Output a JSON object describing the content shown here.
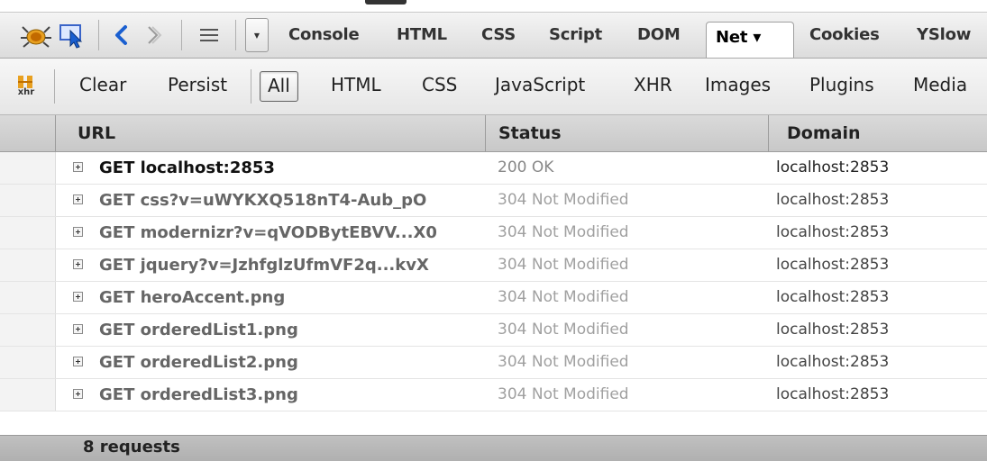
{
  "panel_tabs": [
    {
      "label": "Console"
    },
    {
      "label": "HTML"
    },
    {
      "label": "CSS"
    },
    {
      "label": "Script"
    },
    {
      "label": "DOM"
    },
    {
      "label": "Net ▾",
      "active": true
    },
    {
      "label": "Cookies"
    },
    {
      "label": "YSlow"
    }
  ],
  "toolbar_icons": [
    "firebug-icon",
    "inspect-icon",
    "back-icon",
    "forward-icon",
    "menu-icon",
    "dropdown-icon"
  ],
  "filter_bar": {
    "xhr_icon_label": "xhr",
    "buttons": [
      {
        "label": "Clear"
      },
      {
        "label": "Persist"
      },
      {
        "label": "All",
        "active": true
      },
      {
        "label": "HTML"
      },
      {
        "label": "CSS"
      },
      {
        "label": "JavaScript"
      },
      {
        "label": "XHR"
      },
      {
        "label": "Images"
      },
      {
        "label": "Plugins"
      },
      {
        "label": "Media"
      }
    ]
  },
  "columns": {
    "url": "URL",
    "status": "Status",
    "domain": "Domain"
  },
  "requests": [
    {
      "url": "GET localhost:2853",
      "status": "200 OK",
      "domain": "localhost:2853"
    },
    {
      "url": "GET css?v=uWYKXQ518nT4-Aub_pO",
      "status": "304 Not Modified",
      "domain": "localhost:2853"
    },
    {
      "url": "GET modernizr?v=qVODBytEBVV...X0",
      "status": "304 Not Modified",
      "domain": "localhost:2853"
    },
    {
      "url": "GET jquery?v=JzhfglzUfmVF2q...kvX",
      "status": "304 Not Modified",
      "domain": "localhost:2853"
    },
    {
      "url": "GET heroAccent.png",
      "status": "304 Not Modified",
      "domain": "localhost:2853"
    },
    {
      "url": "GET orderedList1.png",
      "status": "304 Not Modified",
      "domain": "localhost:2853"
    },
    {
      "url": "GET orderedList2.png",
      "status": "304 Not Modified",
      "domain": "localhost:2853"
    },
    {
      "url": "GET orderedList3.png",
      "status": "304 Not Modified",
      "domain": "localhost:2853"
    }
  ],
  "footer": {
    "summary": "8 requests"
  },
  "colors": {
    "accent_blue": "#1a5fd0",
    "firebug_orange": "#e8a020"
  }
}
